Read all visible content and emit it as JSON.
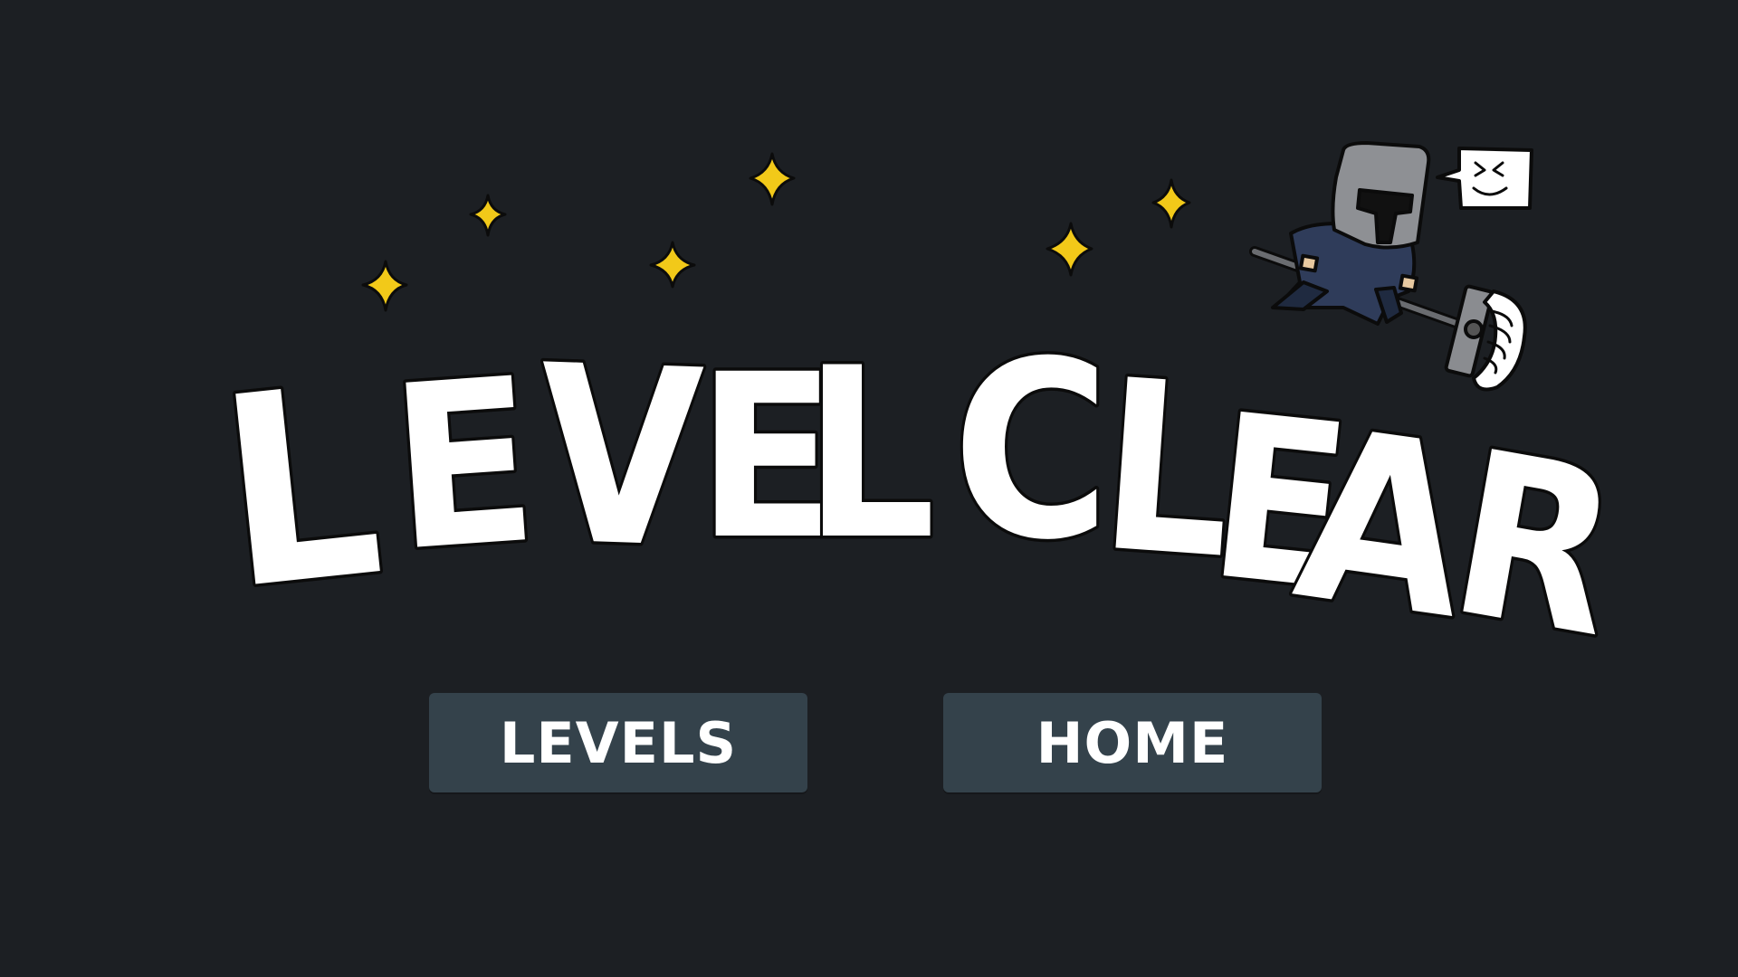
{
  "screen": {
    "background_color": "#1c1f23"
  },
  "title": {
    "letters": [
      "L",
      "E",
      "V",
      "E",
      "L",
      "C",
      "L",
      "E",
      "A",
      "R"
    ],
    "letter_color": "#ffffff",
    "outline_color": "#0b0b0b",
    "sparkle_color": "#f2c919"
  },
  "mascot": {
    "icon": "knight-icon",
    "bubble_icon": "speech-bubble-smile-icon"
  },
  "buttons": {
    "levels_label": "LEVELS",
    "home_label": "HOME",
    "button_color": "#34424b"
  }
}
